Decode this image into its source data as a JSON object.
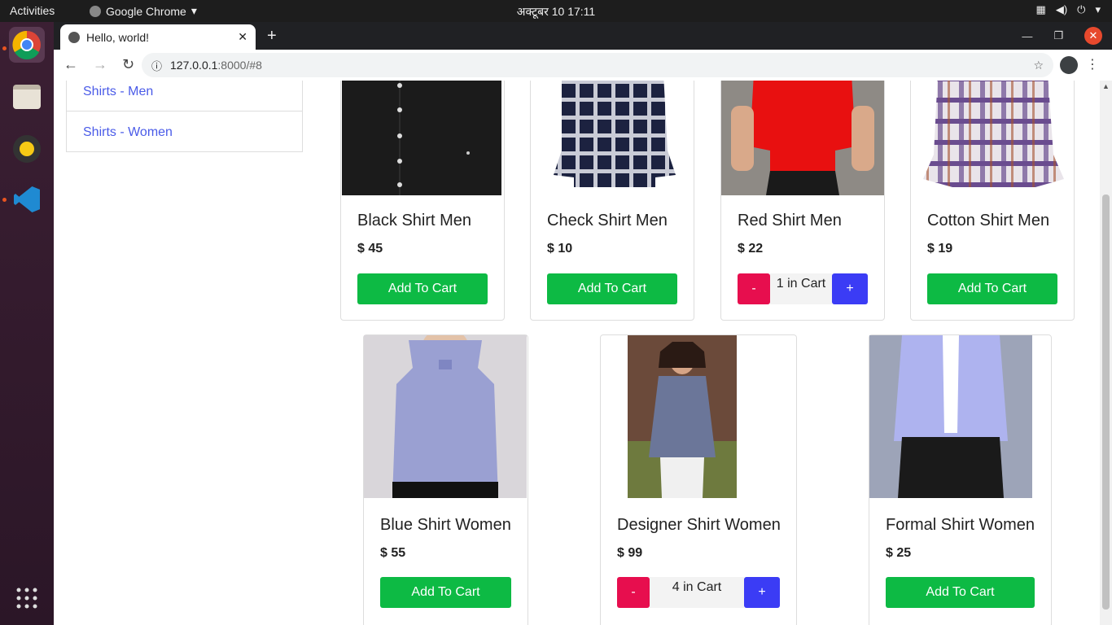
{
  "desktop": {
    "activities": "Activities",
    "app_name": "Google Chrome",
    "clock": "अक्टूबर 10  17:11"
  },
  "browser": {
    "tab_title": "Hello, world!",
    "url_host": "127.0.0.1",
    "url_rest": ":8000/#8"
  },
  "sidebar": {
    "items": [
      {
        "label": "Shirts - Men"
      },
      {
        "label": "Shirts - Women"
      }
    ]
  },
  "products": [
    {
      "title": "Black Shirt Men",
      "price": "$ 45",
      "button": "Add To Cart",
      "in_cart": null
    },
    {
      "title": "Check Shirt Men",
      "price": "$ 10",
      "button": "Add To Cart",
      "in_cart": null
    },
    {
      "title": "Red Shirt Men",
      "price": "$ 22",
      "in_cart": "1 in Cart",
      "minus": "-",
      "plus": "+"
    },
    {
      "title": "Cotton Shirt Men",
      "price": "$ 19",
      "button": "Add To Cart",
      "in_cart": null
    },
    {
      "title": "Blue Shirt Women",
      "price": "$ 55",
      "button": "Add To Cart",
      "in_cart": null
    },
    {
      "title": "Designer Shirt Women",
      "price": "$ 99",
      "in_cart": "4 in Cart",
      "minus": "-",
      "plus": "+"
    },
    {
      "title": "Formal Shirt Women",
      "price": "$ 25",
      "button": "Add To Cart",
      "in_cart": null
    }
  ],
  "colors": {
    "add_button": "#0dba44",
    "minus_button": "#e70e4e",
    "plus_button": "#3b3cf5",
    "link": "#4a5be8"
  }
}
